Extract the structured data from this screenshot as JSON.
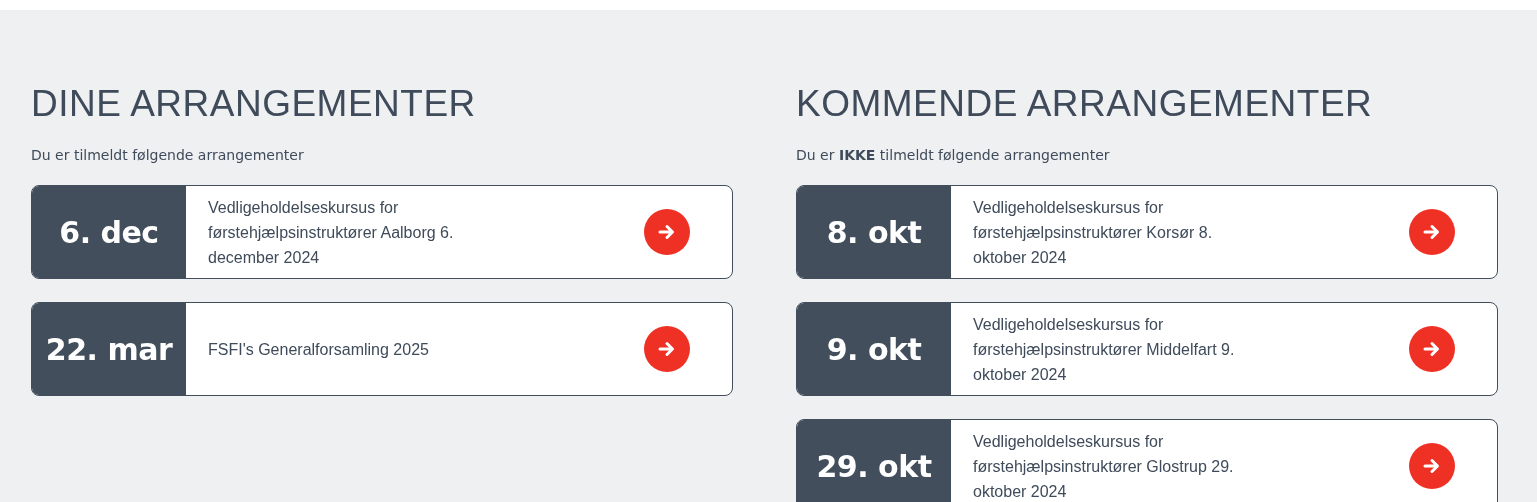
{
  "sections": [
    {
      "title": "DINE ARRANGEMENTER",
      "subtitle": "Du er tilmeldt følgende arrangementer",
      "events": [
        {
          "date": "6. dec",
          "title": "Vedligeholdelseskursus for førstehjælpsinstruktører Aalborg 6. december 2024"
        },
        {
          "date": "22. mar",
          "title": "FSFI's Generalforsamling 2025"
        }
      ]
    },
    {
      "title": "KOMMENDE ARRANGEMENTER",
      "subtitle": "Du er **IKKE** tilmeldt følgende arrangementer",
      "events": [
        {
          "date": "8. okt",
          "title": "Vedligeholdelseskursus for førstehjælpsinstruktører Korsør 8. oktober 2024"
        },
        {
          "date": "9. okt",
          "title": "Vedligeholdelseskursus for førstehjælpsinstruktører Middelfart 9. oktober 2024"
        },
        {
          "date": "29. okt",
          "title": "Vedligeholdelseskursus for førstehjælpsinstruktører Glostrup 29. oktober 2024"
        }
      ]
    }
  ]
}
